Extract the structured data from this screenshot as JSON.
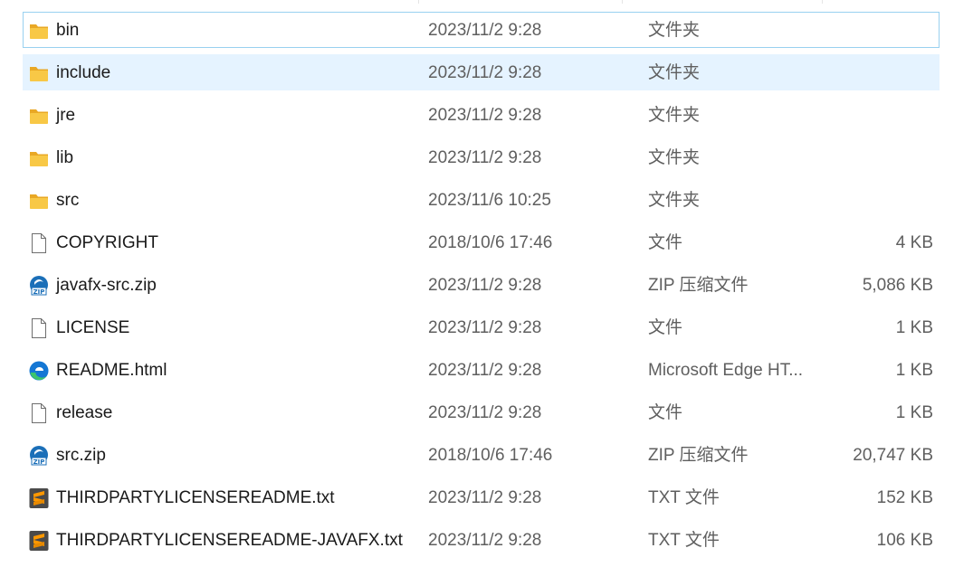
{
  "files": [
    {
      "name": "bin",
      "date": "2023/11/2 9:28",
      "type": "文件夹",
      "size": "",
      "icon": "folder-icon",
      "state": "focused"
    },
    {
      "name": "include",
      "date": "2023/11/2 9:28",
      "type": "文件夹",
      "size": "",
      "icon": "folder-icon",
      "state": "selected"
    },
    {
      "name": "jre",
      "date": "2023/11/2 9:28",
      "type": "文件夹",
      "size": "",
      "icon": "folder-icon",
      "state": ""
    },
    {
      "name": "lib",
      "date": "2023/11/2 9:28",
      "type": "文件夹",
      "size": "",
      "icon": "folder-icon",
      "state": ""
    },
    {
      "name": "src",
      "date": "2023/11/6 10:25",
      "type": "文件夹",
      "size": "",
      "icon": "folder-icon",
      "state": ""
    },
    {
      "name": "COPYRIGHT",
      "date": "2018/10/6 17:46",
      "type": "文件",
      "size": "4 KB",
      "icon": "file-icon",
      "state": ""
    },
    {
      "name": "javafx-src.zip",
      "date": "2023/11/2 9:28",
      "type": "ZIP 压缩文件",
      "size": "5,086 KB",
      "icon": "zip-icon",
      "state": ""
    },
    {
      "name": "LICENSE",
      "date": "2023/11/2 9:28",
      "type": "文件",
      "size": "1 KB",
      "icon": "file-icon",
      "state": ""
    },
    {
      "name": "README.html",
      "date": "2023/11/2 9:28",
      "type": "Microsoft Edge HT...",
      "size": "1 KB",
      "icon": "edge-icon",
      "state": ""
    },
    {
      "name": "release",
      "date": "2023/11/2 9:28",
      "type": "文件",
      "size": "1 KB",
      "icon": "file-icon",
      "state": ""
    },
    {
      "name": "src.zip",
      "date": "2018/10/6 17:46",
      "type": "ZIP 压缩文件",
      "size": "20,747 KB",
      "icon": "zip-icon",
      "state": ""
    },
    {
      "name": "THIRDPARTYLICENSEREADME.txt",
      "date": "2023/11/2 9:28",
      "type": "TXT 文件",
      "size": "152 KB",
      "icon": "sublime-text-icon",
      "state": ""
    },
    {
      "name": "THIRDPARTYLICENSEREADME-JAVAFX.txt",
      "date": "2023/11/2 9:28",
      "type": "TXT 文件",
      "size": "106 KB",
      "icon": "sublime-text-icon",
      "state": ""
    }
  ],
  "colors": {
    "folder": "#f8c846",
    "folder_dark": "#e9a825",
    "selection_bg": "#e5f3ff",
    "focus_border": "#99d1f0",
    "zip": "#1b6fb8",
    "edge_blue": "#1477d4",
    "edge_green": "#3cc56c",
    "sublime_bg": "#4a4a4a",
    "sublime_orange": "#ff9800"
  },
  "zip_badge_text": "ZIP"
}
